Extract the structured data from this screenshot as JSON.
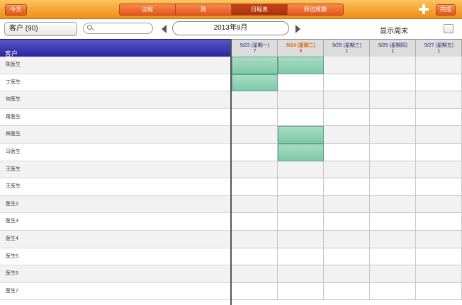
{
  "toolbar": {
    "today_label": "今天",
    "done_label": "完成",
    "add_icon": "plus-icon",
    "tabs": [
      {
        "label": "议程",
        "active": false
      },
      {
        "label": "周",
        "active": false
      },
      {
        "label": "日程表",
        "active": true
      },
      {
        "label": "拜访周期",
        "active": false
      }
    ]
  },
  "filter": {
    "client_button_label": "客户 (90)",
    "search_placeholder": "",
    "search_icon": "search-icon",
    "month_label": "2013年9月",
    "show_weekend_label": "显示周末",
    "show_weekend_checked": false
  },
  "grid": {
    "client_header": "客户",
    "days": [
      {
        "label": "9/23 (星期一)",
        "count": "7",
        "today": false
      },
      {
        "label": "9/24 (星期二)",
        "count": "6",
        "today": true
      },
      {
        "label": "9/25 (星期三)",
        "count": "1",
        "today": false
      },
      {
        "label": "9/26 (星期四)",
        "count": "1",
        "today": false
      },
      {
        "label": "9/27 (星期五)",
        "count": "1",
        "today": false
      }
    ],
    "clients": [
      {
        "name": "陈医生",
        "booked": [
          0,
          1
        ]
      },
      {
        "name": "丁医生",
        "booked": [
          0
        ]
      },
      {
        "name": "何医生",
        "booked": []
      },
      {
        "name": "蒋医生",
        "booked": []
      },
      {
        "name": "林医生",
        "booked": [
          1
        ]
      },
      {
        "name": "马医生",
        "booked": [
          1
        ]
      },
      {
        "name": "王医生",
        "booked": []
      },
      {
        "name": "王医生",
        "booked": []
      },
      {
        "name": "医生2",
        "booked": []
      },
      {
        "name": "医生3",
        "booked": []
      },
      {
        "name": "医生4",
        "booked": []
      },
      {
        "name": "医生5",
        "booked": []
      },
      {
        "name": "医生6",
        "booked": []
      },
      {
        "name": "医生7",
        "booked": []
      }
    ]
  },
  "colors": {
    "toolbar_orange": "#f5a431",
    "button_orange": "#e4541e",
    "header_blue": "#2c24a0",
    "booked_green": "#8fd0b3",
    "today_orange": "#e2681a"
  }
}
